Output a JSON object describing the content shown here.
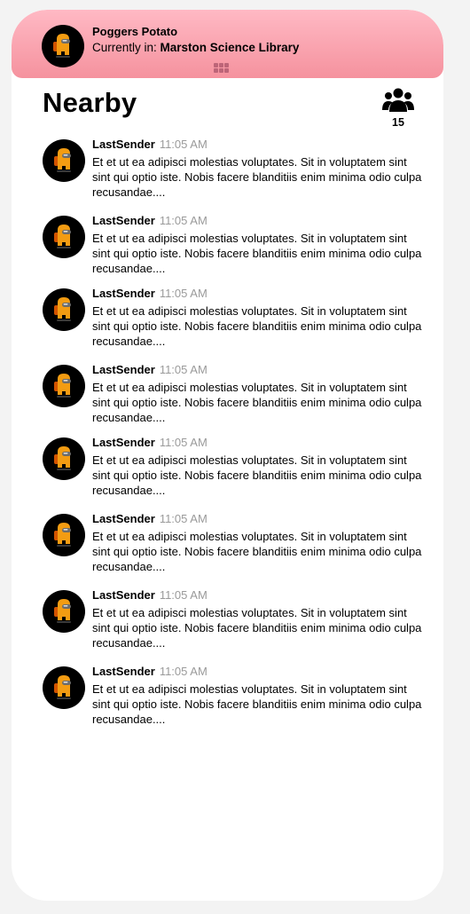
{
  "header": {
    "user_name": "Poggers Potato",
    "location_label": "Currently in:",
    "location_value": "Marston Science Library",
    "avatar_icon": "crewmate-avatar-icon",
    "colors": {
      "gradient_top": "#ffb9c4",
      "gradient_bottom": "#f5929e"
    }
  },
  "nearby": {
    "title": "Nearby",
    "people_icon": "people-group-icon",
    "people_count": "15"
  },
  "messages": [
    {
      "sender": "LastSender",
      "time": "11:05 AM",
      "text": "Et et ut ea adipisci molestias voluptates. Sit in voluptatem sint sint qui optio iste. Nobis facere blanditiis enim minima odio culpa recusandae...."
    },
    {
      "sender": "LastSender",
      "time": "11:05 AM",
      "text": "Et et ut ea adipisci molestias voluptates. Sit in voluptatem sint sint qui optio iste. Nobis facere blanditiis enim minima odio culpa recusandae...."
    },
    {
      "sender": "LastSender",
      "time": "11:05 AM",
      "text": "Et et ut ea adipisci molestias voluptates. Sit in voluptatem sint sint qui optio iste. Nobis facere blanditiis enim minima odio culpa recusandae...."
    },
    {
      "sender": "LastSender",
      "time": "11:05 AM",
      "text": "Et et ut ea adipisci molestias voluptates. Sit in voluptatem sint sint qui optio iste. Nobis facere blanditiis enim minima odio culpa recusandae...."
    },
    {
      "sender": "LastSender",
      "time": "11:05 AM",
      "text": "Et et ut ea adipisci molestias voluptates. Sit in voluptatem sint sint qui optio iste. Nobis facere blanditiis enim minima odio culpa recusandae...."
    },
    {
      "sender": "LastSender",
      "time": "11:05 AM",
      "text": "Et et ut ea adipisci molestias voluptates. Sit in voluptatem sint sint qui optio iste. Nobis facere blanditiis enim minima odio culpa recusandae...."
    },
    {
      "sender": "LastSender",
      "time": "11:05 AM",
      "text": "Et et ut ea adipisci molestias voluptates. Sit in voluptatem sint sint qui optio iste. Nobis facere blanditiis enim minima odio culpa recusandae...."
    },
    {
      "sender": "LastSender",
      "time": "11:05 AM",
      "text": "Et et ut ea adipisci molestias voluptates. Sit in voluptatem sint sint qui optio iste. Nobis facere blanditiis enim minima odio culpa recusandae...."
    }
  ]
}
